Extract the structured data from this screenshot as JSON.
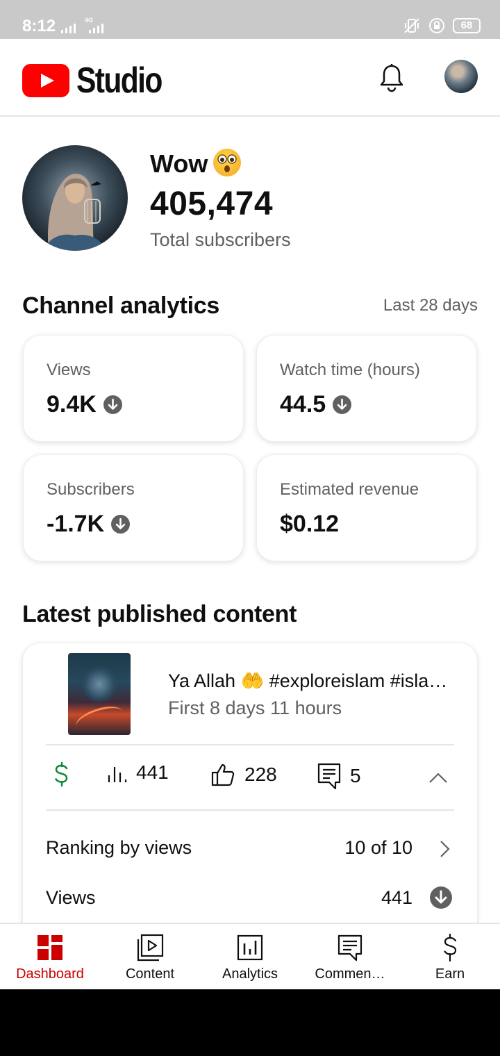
{
  "status_bar": {
    "time": "8:12",
    "network": "4G",
    "battery": "68"
  },
  "app_bar": {
    "title": "Studio"
  },
  "profile": {
    "channel_name": "Wow",
    "subscriber_count": "405,474",
    "subscriber_label": "Total subscribers"
  },
  "analytics": {
    "title": "Channel analytics",
    "range": "Last 28 days",
    "cards": [
      {
        "label": "Views",
        "value": "9.4K",
        "trend": "down"
      },
      {
        "label": "Watch time (hours)",
        "value": "44.5",
        "trend": "down"
      },
      {
        "label": "Subscribers",
        "value": "-1.7K",
        "trend": "down"
      },
      {
        "label": "Estimated revenue",
        "value": "$0.12",
        "trend": "none"
      }
    ]
  },
  "latest": {
    "title": "Latest published content",
    "video": {
      "title": "Ya Allah 🤲 #exploreislam #isla…",
      "subtitle": "First 8 days 11 hours",
      "views": "441",
      "likes": "228",
      "comments": "5"
    },
    "ranking_label": "Ranking by views",
    "ranking_value": "10 of 10",
    "views_label": "Views",
    "views_value": "441"
  },
  "nav": {
    "items": [
      {
        "label": "Dashboard",
        "icon": "dashboard-icon",
        "active": true
      },
      {
        "label": "Content",
        "icon": "content-icon",
        "active": false
      },
      {
        "label": "Analytics",
        "icon": "analytics-icon",
        "active": false
      },
      {
        "label": "Commen…",
        "icon": "comments-icon",
        "active": false
      },
      {
        "label": "Earn",
        "icon": "earn-icon",
        "active": false
      }
    ]
  },
  "colors": {
    "brand_red": "#ff0000",
    "active_nav": "#cc0000",
    "monetization_green": "#0a8a35"
  }
}
